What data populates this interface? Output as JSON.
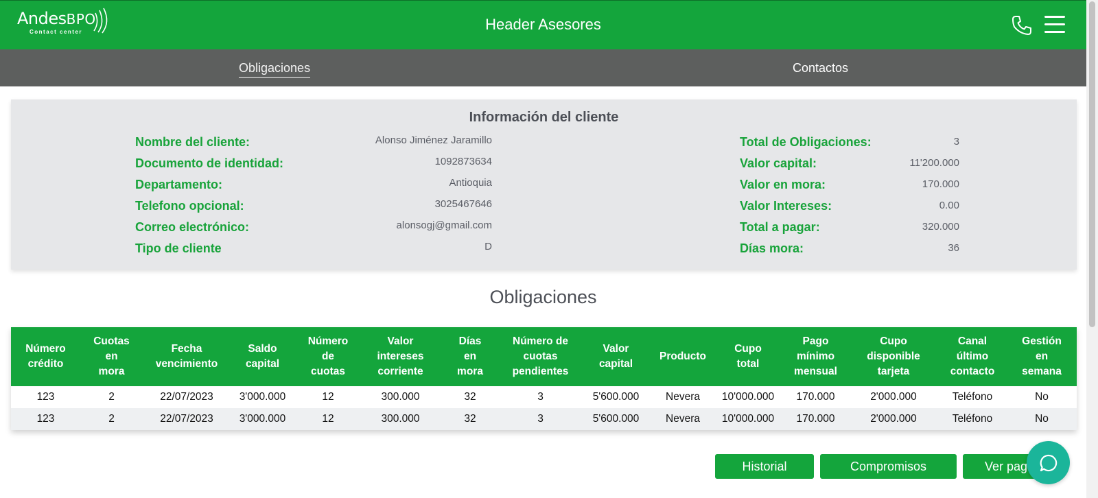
{
  "header": {
    "logo_main": "Andes",
    "logo_bpo": "BPO",
    "logo_sub": "Contact center",
    "title": "Header Asesores",
    "phone_icon": "phone-icon",
    "menu_icon": "hamburger-menu-icon"
  },
  "nav": {
    "tabs": [
      {
        "label": "Obligaciones",
        "active": true
      },
      {
        "label": "Contactos",
        "active": false
      }
    ]
  },
  "client_info": {
    "title": "Información del cliente",
    "left": [
      {
        "label": "Nombre del cliente:",
        "value": "Alonso Jiménez Jaramillo"
      },
      {
        "label": "Documento de identidad:",
        "value": "1092873634"
      },
      {
        "label": "Departamento:",
        "value": "Antioquia"
      },
      {
        "label": "Telefono opcional:",
        "value": "3025467646"
      },
      {
        "label": "Correo electrónico:",
        "value": "alonsogj@gmail.com"
      },
      {
        "label": "Tipo de cliente",
        "value": "D"
      }
    ],
    "right": [
      {
        "label": "Total de Obligaciones:",
        "value": "3"
      },
      {
        "label": "Valor capital:",
        "value": "11'200.000"
      },
      {
        "label": "Valor en mora:",
        "value": "170.000"
      },
      {
        "label": "Valor Intereses:",
        "value": "0.00"
      },
      {
        "label": "Total a pagar:",
        "value": "320.000"
      },
      {
        "label": "Días mora:",
        "value": "36"
      }
    ]
  },
  "obligations": {
    "title": "Obligaciones",
    "columns": [
      [
        "Número",
        "crédito"
      ],
      [
        "Cuotas",
        "en",
        "mora"
      ],
      [
        "Fecha",
        "vencimiento"
      ],
      [
        "Saldo",
        "capital"
      ],
      [
        "Número",
        "de",
        "cuotas"
      ],
      [
        "Valor",
        "intereses",
        "corriente"
      ],
      [
        "Días",
        "en",
        "mora"
      ],
      [
        "Número de",
        "cuotas",
        "pendientes"
      ],
      [
        "Valor",
        "capital"
      ],
      [
        "Producto"
      ],
      [
        "Cupo",
        "total"
      ],
      [
        "Pago",
        "mínimo",
        "mensual"
      ],
      [
        "Cupo",
        "disponible",
        "tarjeta"
      ],
      [
        "Canal",
        "último",
        "contacto"
      ],
      [
        "Gestión",
        "en",
        "semana"
      ]
    ],
    "rows": [
      [
        "123",
        "2",
        "22/07/2023",
        "3'000.000",
        "12",
        "300.000",
        "32",
        "3",
        "5'600.000",
        "Nevera",
        "10'000.000",
        "170.000",
        "2'000.000",
        "Teléfono",
        "No"
      ],
      [
        "123",
        "2",
        "22/07/2023",
        "3'000.000",
        "12",
        "300.000",
        "32",
        "3",
        "5'600.000",
        "Nevera",
        "10'000.000",
        "170.000",
        "2'000.000",
        "Teléfono",
        "No"
      ]
    ]
  },
  "actions": {
    "historial": "Historial",
    "compromisos": "Compromisos",
    "ver_pagos": "Ver pagos",
    "chat_icon": "chat-bubble-icon"
  },
  "colors": {
    "brand_green": "#14a53c",
    "nav_gray": "#5d5f5e",
    "card_bg": "#e6e7e9",
    "label_green": "#18a33a",
    "chat_teal": "#1bb59a"
  }
}
